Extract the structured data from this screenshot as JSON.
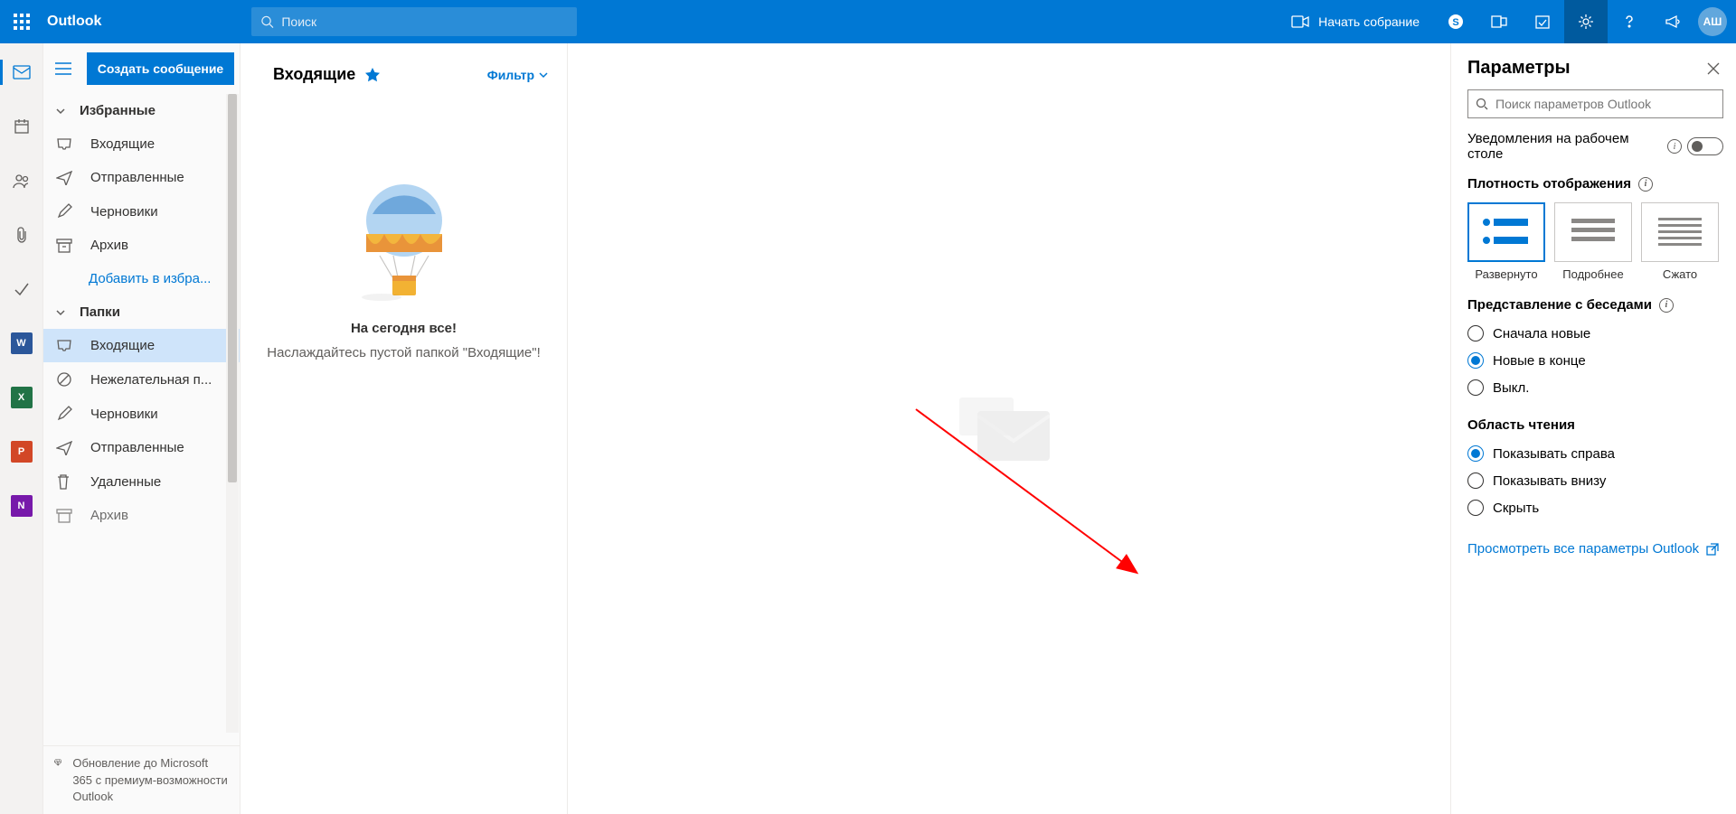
{
  "header": {
    "brand": "Outlook",
    "search_placeholder": "Поиск",
    "meet_label": "Начать собрание",
    "avatar_initials": "АШ"
  },
  "compose_button": "Создать сообщение",
  "favorites": {
    "title": "Избранные",
    "items": [
      {
        "label": "Входящие",
        "icon": "inbox"
      },
      {
        "label": "Отправленные",
        "icon": "sent"
      },
      {
        "label": "Черновики",
        "icon": "draft"
      },
      {
        "label": "Архив",
        "icon": "archive"
      }
    ],
    "add_label": "Добавить в избра..."
  },
  "folders": {
    "title": "Папки",
    "items": [
      {
        "label": "Входящие",
        "icon": "inbox",
        "selected": true
      },
      {
        "label": "Нежелательная п...",
        "icon": "junk"
      },
      {
        "label": "Черновики",
        "icon": "draft"
      },
      {
        "label": "Отправленные",
        "icon": "sent"
      },
      {
        "label": "Удаленные",
        "icon": "trash"
      },
      {
        "label": "Архив",
        "icon": "archive"
      }
    ]
  },
  "upgrade_text": "Обновление до Microsoft 365 с премиум-возможности Outlook",
  "msglist": {
    "title": "Входящие",
    "filter": "Фильтр",
    "empty_title": "На сегодня все!",
    "empty_sub": "Наслаждайтесь пустой папкой \"Входящие\"!"
  },
  "settings": {
    "title": "Параметры",
    "search_placeholder": "Поиск параметров Outlook",
    "desktop_notif": "Уведомления на рабочем столе",
    "density_title": "Плотность отображения",
    "density_options": [
      "Развернуто",
      "Подробнее",
      "Сжато"
    ],
    "conversation_title": "Представление с беседами",
    "conversation_options": [
      "Сначала новые",
      "Новые в конце",
      "Выкл."
    ],
    "conversation_selected": 1,
    "reading_title": "Область чтения",
    "reading_options": [
      "Показывать справа",
      "Показывать внизу",
      "Скрыть"
    ],
    "reading_selected": 0,
    "view_all": "Просмотреть все параметры Outlook"
  }
}
